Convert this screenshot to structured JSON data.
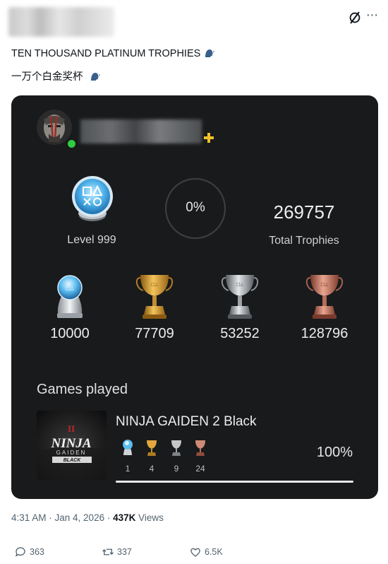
{
  "tweet": {
    "line1": "TEN THOUSAND PLATINUM TROPHIES",
    "line2": "一万个白金奖杯",
    "timestamp": "4:31 AM · Jan 4, 2026 · ",
    "views_count": "437K",
    "views_label": " Views",
    "reply_count": "363",
    "retweet_count": "337",
    "like_count": "6.5K"
  },
  "profile": {
    "level_label": "Level 999",
    "progress_text": "0%",
    "progress_value": 0,
    "total_trophies": "269757",
    "total_label": "Total Trophies"
  },
  "trophies": [
    {
      "type": "platinum",
      "count": "10000"
    },
    {
      "type": "gold",
      "count": "77709"
    },
    {
      "type": "silver",
      "count": "53252"
    },
    {
      "type": "bronze",
      "count": "128796"
    }
  ],
  "games": {
    "heading": "Games played",
    "items": [
      {
        "title": "NINJA GAIDEN 2 Black",
        "art_lines": [
          "NINJA",
          "GAIDEN",
          "BLACK"
        ],
        "art_mark": "II",
        "counts": [
          "1",
          "4",
          "9",
          "24"
        ],
        "completion": "100%",
        "completion_value": 1.0
      }
    ]
  },
  "colors": {
    "card_bg": "#181a1c",
    "platinum": "#8fd3ff",
    "gold": "#d8a03c",
    "silver": "#b5b5b5",
    "bronze": "#c8796a",
    "online": "#2ecc40",
    "plus": "#f0c12c"
  },
  "icons": [
    "grok-icon",
    "more-icon",
    "speaking-head-icon",
    "playstation-plus-icon",
    "reply-icon",
    "retweet-icon",
    "like-icon"
  ]
}
